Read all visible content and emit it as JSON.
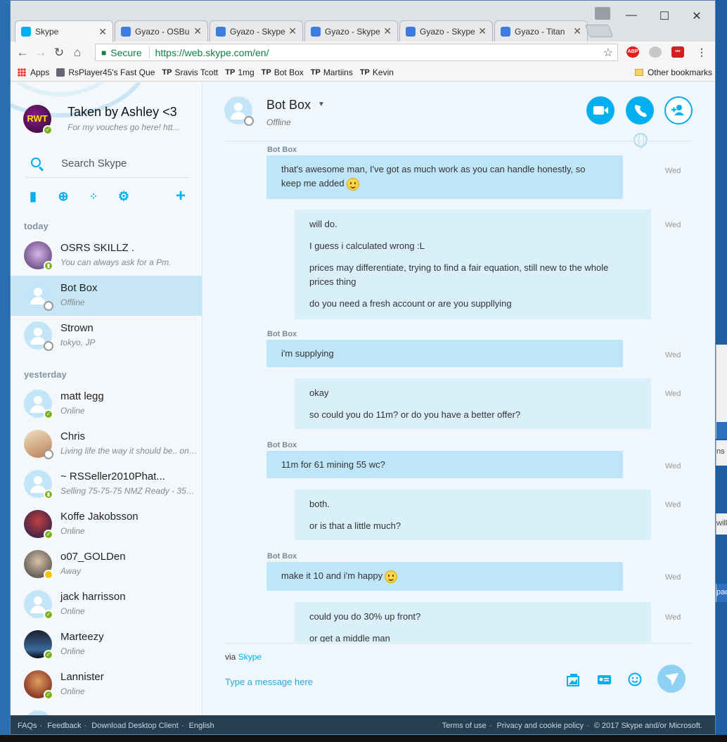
{
  "browser": {
    "tabs": [
      {
        "title": "Skype",
        "active": true,
        "icon": "skype-icon"
      },
      {
        "title": "Gyazo - OSBu",
        "icon": "gyazo-icon"
      },
      {
        "title": "Gyazo - Skype",
        "icon": "gyazo-icon"
      },
      {
        "title": "Gyazo - Skype",
        "icon": "gyazo-icon"
      },
      {
        "title": "Gyazo - Skype",
        "icon": "gyazo-icon"
      },
      {
        "title": "Gyazo - Titan",
        "icon": "gyazo-icon"
      }
    ],
    "secure_label": "Secure",
    "url": "https://web.skype.com/en/",
    "extensions": [
      "ABP"
    ],
    "bookmarks": {
      "apps": "Apps",
      "items": [
        "RsPlayer45's Fast Que",
        "Sravis Tcott",
        "1mg",
        "Bot Box",
        "Martiins",
        "Kevin"
      ],
      "tp_prefix": "TP",
      "other": "Other bookmarks"
    }
  },
  "me": {
    "name": "Taken by Ashley <3",
    "mood": "For my vouches go here! htt...",
    "avatar_text": "RWT",
    "search_placeholder": "Search Skype"
  },
  "sections": {
    "today": "today",
    "yesterday": "yesterday"
  },
  "contacts_today": [
    {
      "name": "OSRS SKILLZ .",
      "mood": "You can always ask for a Pm.",
      "status": "mobile",
      "photo": true
    },
    {
      "name": "Bot Box",
      "mood": "Offline",
      "status": "offline",
      "photo": false,
      "selected": true
    },
    {
      "name": "Strown",
      "mood": "tokyo, JP",
      "status": "offline",
      "photo": false
    }
  ],
  "contacts_yesterday": [
    {
      "name": "matt legg",
      "mood": "Online",
      "status": "online",
      "photo": false
    },
    {
      "name": "Chris",
      "mood": "Living life the way it should be.. onl...",
      "status": "offline",
      "photo": true
    },
    {
      "name": "~ RSSeller2010Phat...",
      "mood": "Selling 75-75-75 NMZ Ready - 35M...",
      "status": "mobile",
      "photo": false
    },
    {
      "name": "Koffe Jakobsson",
      "mood": "Online",
      "status": "online",
      "photo": true
    },
    {
      "name": "o07_GOLDen",
      "mood": "Away",
      "status": "away",
      "photo": true
    },
    {
      "name": "jack harrisson",
      "mood": "Online",
      "status": "online",
      "photo": false
    },
    {
      "name": "Marteezy",
      "mood": "Online",
      "status": "online",
      "photo": true
    },
    {
      "name": "Lannister",
      "mood": "Online",
      "status": "online",
      "photo": true
    }
  ],
  "chat": {
    "name": "Bot Box",
    "status": "Offline",
    "messages": [
      {
        "sender": "Bot Box",
        "from": "them",
        "time": "Wed",
        "lines": [
          "that's awesome man, I've got as much work as you can handle honestly, so",
          "keep me added"
        ],
        "smiley": true
      },
      {
        "from": "me",
        "time": "Wed",
        "lines": [
          "will do.",
          "I guess i calculated wrong :L",
          "prices may differentiate, trying to find a fair equation, still new to the whole",
          "prices thing",
          "do you need a fresh account or are you suppllying"
        ]
      },
      {
        "sender": "Bot Box",
        "from": "them",
        "time": "Wed",
        "lines": [
          "i'm supplying"
        ]
      },
      {
        "from": "me",
        "time": "Wed",
        "lines": [
          "okay",
          "so could you do 11m? or do you have a better offer?"
        ]
      },
      {
        "sender": "Bot Box",
        "from": "them",
        "time": "Wed",
        "lines": [
          "11m for 61 mining 55 wc?"
        ]
      },
      {
        "from": "me",
        "time": "Wed",
        "lines": [
          "both.",
          "or is that a little much?"
        ]
      },
      {
        "sender": "Bot Box",
        "from": "them",
        "time": "Wed",
        "lines": [
          "make it 10 and i'm happy"
        ],
        "smiley": true
      },
      {
        "from": "me",
        "time": "Wed",
        "lines": [
          "could you do 30% up front?",
          "or get a middle man"
        ]
      }
    ],
    "via_prefix": "via",
    "via_link": "Skype",
    "input_placeholder": "Type a message here"
  },
  "footer": {
    "left": [
      "FAQs",
      "Feedback",
      "Download Desktop Client",
      "English"
    ],
    "right": [
      "Terms of use",
      "Privacy and cookie policy",
      "© 2017 Skype and/or Microsoft."
    ]
  },
  "background_window": {
    "fragments": [
      "ns",
      "will",
      "pad"
    ]
  },
  "colors": {
    "skype_blue": "#00aff0",
    "bubble_them": "#bfe6f8",
    "bubble_me": "#d9f0fb",
    "online": "#7ab317",
    "away": "#f5c400",
    "footer": "#263e4f"
  }
}
